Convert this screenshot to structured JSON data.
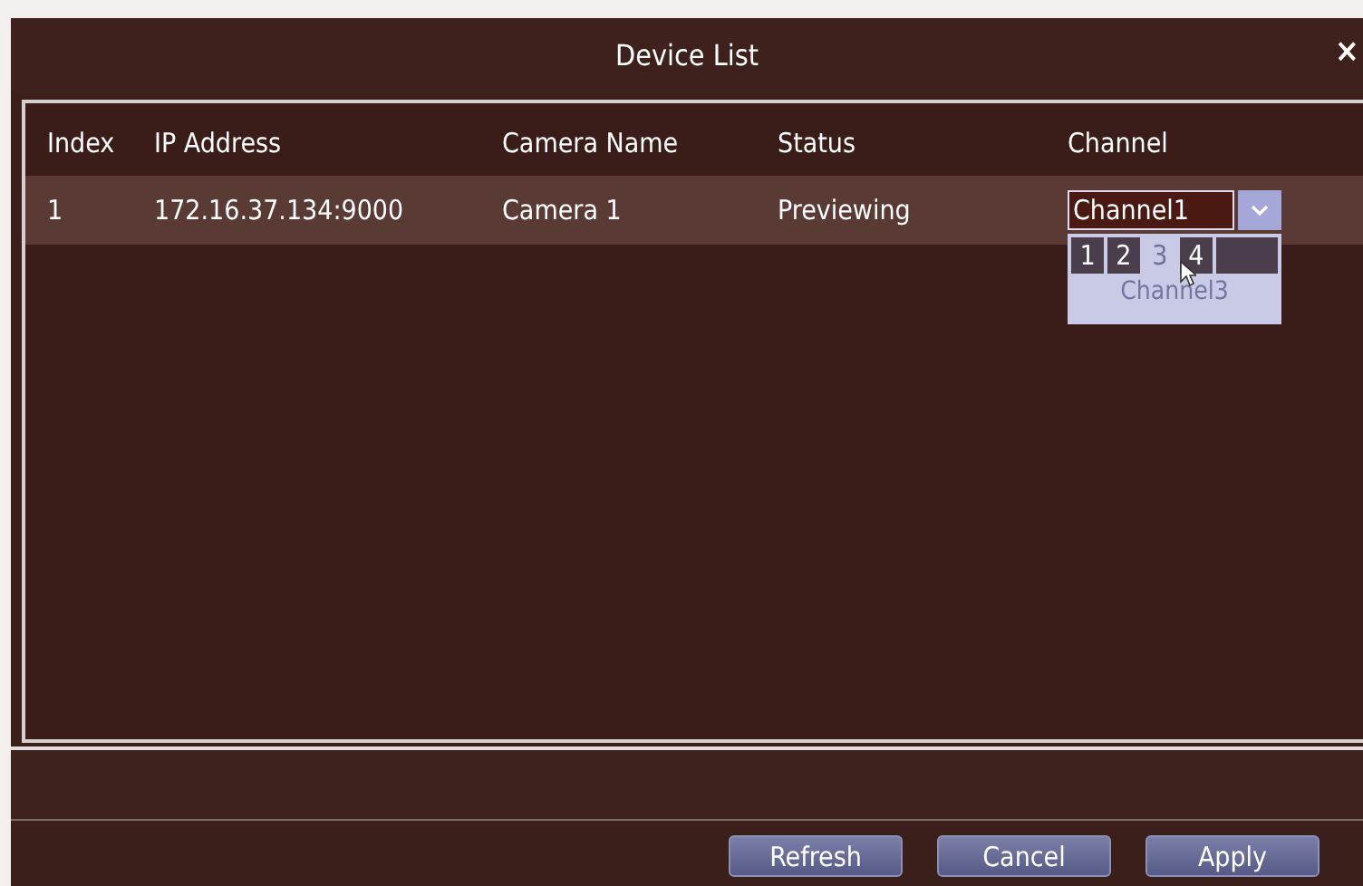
{
  "window": {
    "title": "Device List",
    "close": "×"
  },
  "table": {
    "columns": [
      "Index",
      "IP Address",
      "Camera Name",
      "Status",
      "Channel"
    ],
    "rows": [
      {
        "index": "1",
        "ip_address": "172.16.37.134:9000",
        "camera_name": "Camera 1",
        "status": "Previewing",
        "channel": {
          "value": "Channel1",
          "expanded": true,
          "options": [
            {
              "label": "1",
              "selected": false
            },
            {
              "label": "2",
              "selected": false
            },
            {
              "label": "3",
              "selected": true
            },
            {
              "label": "4",
              "selected": false
            }
          ],
          "hint": "Channel3"
        }
      }
    ]
  },
  "buttons": [
    "Refresh",
    "Cancel",
    "Apply"
  ]
}
